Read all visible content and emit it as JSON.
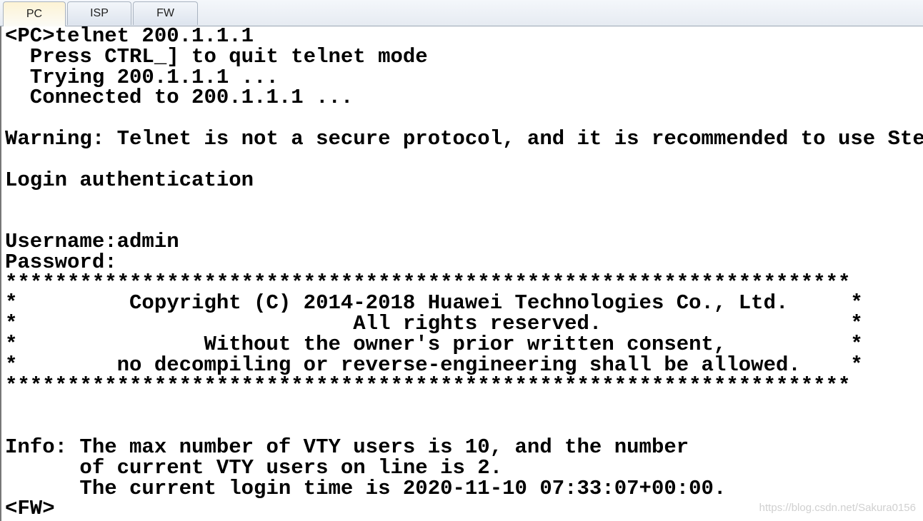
{
  "tabs": [
    {
      "label": "PC",
      "active": true
    },
    {
      "label": "ISP",
      "active": false
    },
    {
      "label": "FW",
      "active": false
    }
  ],
  "terminal": {
    "lines": [
      "<PC>telnet 200.1.1.1",
      "  Press CTRL_] to quit telnet mode",
      "  Trying 200.1.1.1 ...",
      "  Connected to 200.1.1.1 ...",
      "",
      "Warning: Telnet is not a secure protocol, and it is recommended to use Stelnet.",
      "",
      "Login authentication",
      "",
      "",
      "Username:admin",
      "Password:",
      "********************************************************************",
      "*         Copyright (C) 2014-2018 Huawei Technologies Co., Ltd.     *",
      "*                           All rights reserved.                    *",
      "*               Without the owner's prior written consent,          *",
      "*        no decompiling or reverse-engineering shall be allowed.    *",
      "********************************************************************",
      "",
      "",
      "Info: The max number of VTY users is 10, and the number",
      "      of current VTY users on line is 2.",
      "      The current login time is 2020-11-10 07:33:07+00:00.",
      "<FW>"
    ]
  },
  "watermark": "https://blog.csdn.net/Sakura0156"
}
